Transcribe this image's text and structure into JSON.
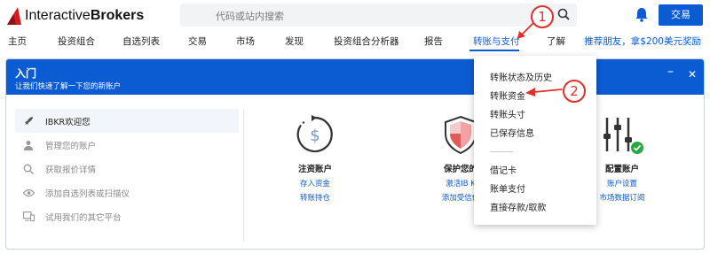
{
  "header": {
    "logo_regular": "Interactive",
    "logo_bold": "Brokers",
    "search_placeholder": "代码或站内搜索",
    "trade_button": "交易"
  },
  "nav": {
    "items": [
      "主页",
      "投资组合",
      "自选列表",
      "交易",
      "市场",
      "发现",
      "投资组合分析器",
      "报告",
      "转账与支付",
      "了解"
    ],
    "promo": "推荐朋友，拿$200美元奖励"
  },
  "panel": {
    "title": "入门",
    "subtitle": "让我们快速了解一下您的新账户",
    "sidebar": [
      {
        "label": "IBKR欢迎您",
        "icon": "rocket-icon"
      },
      {
        "label": "管理您的账户",
        "icon": "user-icon"
      },
      {
        "label": "获取报价详情",
        "icon": "search-icon"
      },
      {
        "label": "添加自选列表或扫描仪",
        "icon": "eye-icon"
      },
      {
        "label": "试用我们的其它平台",
        "icon": "devices-icon"
      }
    ],
    "cards": [
      {
        "title": "注资账户",
        "links": [
          "存入资金",
          "转账持仓"
        ],
        "icon": "dollar-cycle-icon"
      },
      {
        "title": "保护您的",
        "links": [
          "激活IB K",
          "添加受信任"
        ],
        "icon": "shield-icon"
      },
      {
        "title": "配置账户",
        "links": [
          "账户设置",
          "市场数据订阅"
        ],
        "icon": "sliders-icon"
      }
    ]
  },
  "dropdown": {
    "items": [
      "转账状态及历史",
      "转账资金",
      "转账头寸",
      "已保存信息",
      "借记卡",
      "账单支付",
      "直接存款/取款"
    ]
  },
  "annotations": {
    "marker_1": "1",
    "marker_2": "2",
    "color": "#e0302a"
  },
  "colors": {
    "brand": "#0b5bd3",
    "logo_red": "#d71920"
  }
}
